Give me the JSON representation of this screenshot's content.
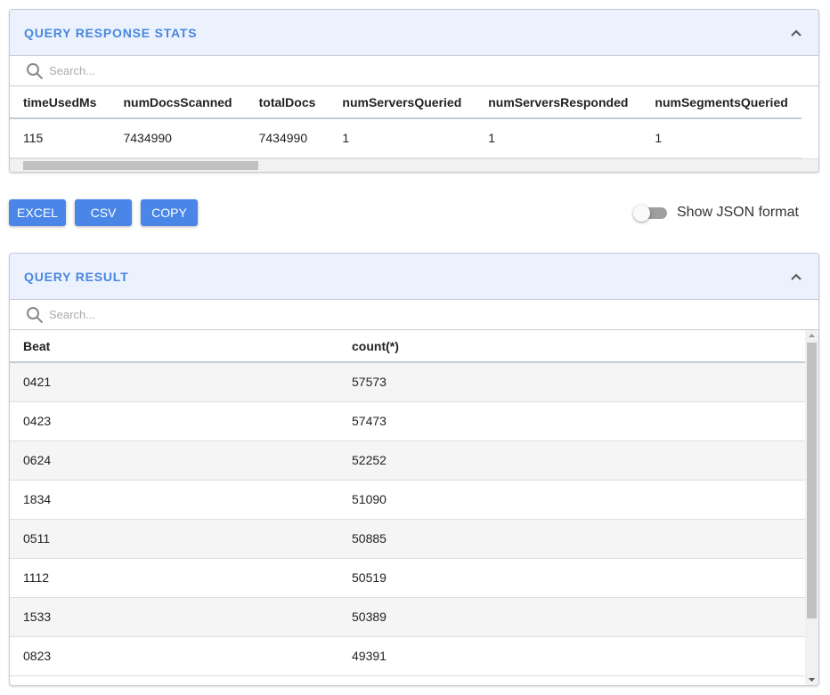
{
  "stats": {
    "title": "QUERY RESPONSE STATS",
    "search_placeholder": "Search...",
    "columns": [
      "timeUsedMs",
      "numDocsScanned",
      "totalDocs",
      "numServersQueried",
      "numServersResponded",
      "numSegmentsQueried"
    ],
    "row": [
      "115",
      "7434990",
      "7434990",
      "1",
      "1",
      "1"
    ]
  },
  "actions": {
    "excel": "EXCEL",
    "csv": "CSV",
    "copy": "COPY",
    "json_toggle_label": "Show JSON format",
    "json_toggle_on": false
  },
  "result": {
    "title": "QUERY RESULT",
    "search_placeholder": "Search...",
    "columns": [
      "Beat",
      "count(*)"
    ],
    "rows": [
      [
        "0421",
        "57573"
      ],
      [
        "0423",
        "57473"
      ],
      [
        "0624",
        "52252"
      ],
      [
        "1834",
        "51090"
      ],
      [
        "0511",
        "50885"
      ],
      [
        "1112",
        "50519"
      ],
      [
        "1533",
        "50389"
      ],
      [
        "0823",
        "49391"
      ]
    ]
  },
  "colors": {
    "accent": "#4a86e8",
    "header_bg": "#ebf2fd"
  }
}
